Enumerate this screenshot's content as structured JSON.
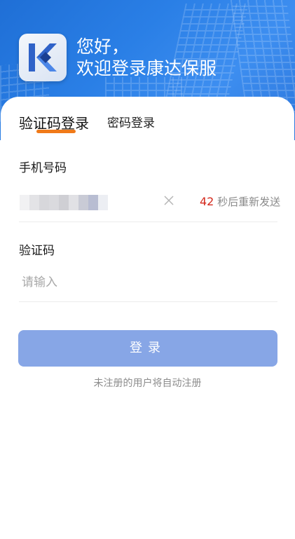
{
  "header": {
    "greeting_line1": "您好，",
    "greeting_line2": "欢迎登录康达保服",
    "logo_text": "K"
  },
  "tabs": [
    {
      "label": "验证码登录",
      "active": true
    },
    {
      "label": "密码登录",
      "active": false
    }
  ],
  "phone": {
    "label": "手机号码",
    "value_masked": true,
    "resend_seconds": "42",
    "resend_text": "秒后重新发送"
  },
  "code": {
    "label": "验证码",
    "placeholder": "请输入",
    "value": ""
  },
  "login_button": {
    "label": "登录"
  },
  "hint": "未注册的用户将自动注册",
  "colors": {
    "header_blue": "#2a7fe6",
    "tab_underline": "#f07a19",
    "button": "#87a6e6",
    "countdown_red": "#d4281c"
  },
  "icons": {
    "clear": "close-icon"
  }
}
